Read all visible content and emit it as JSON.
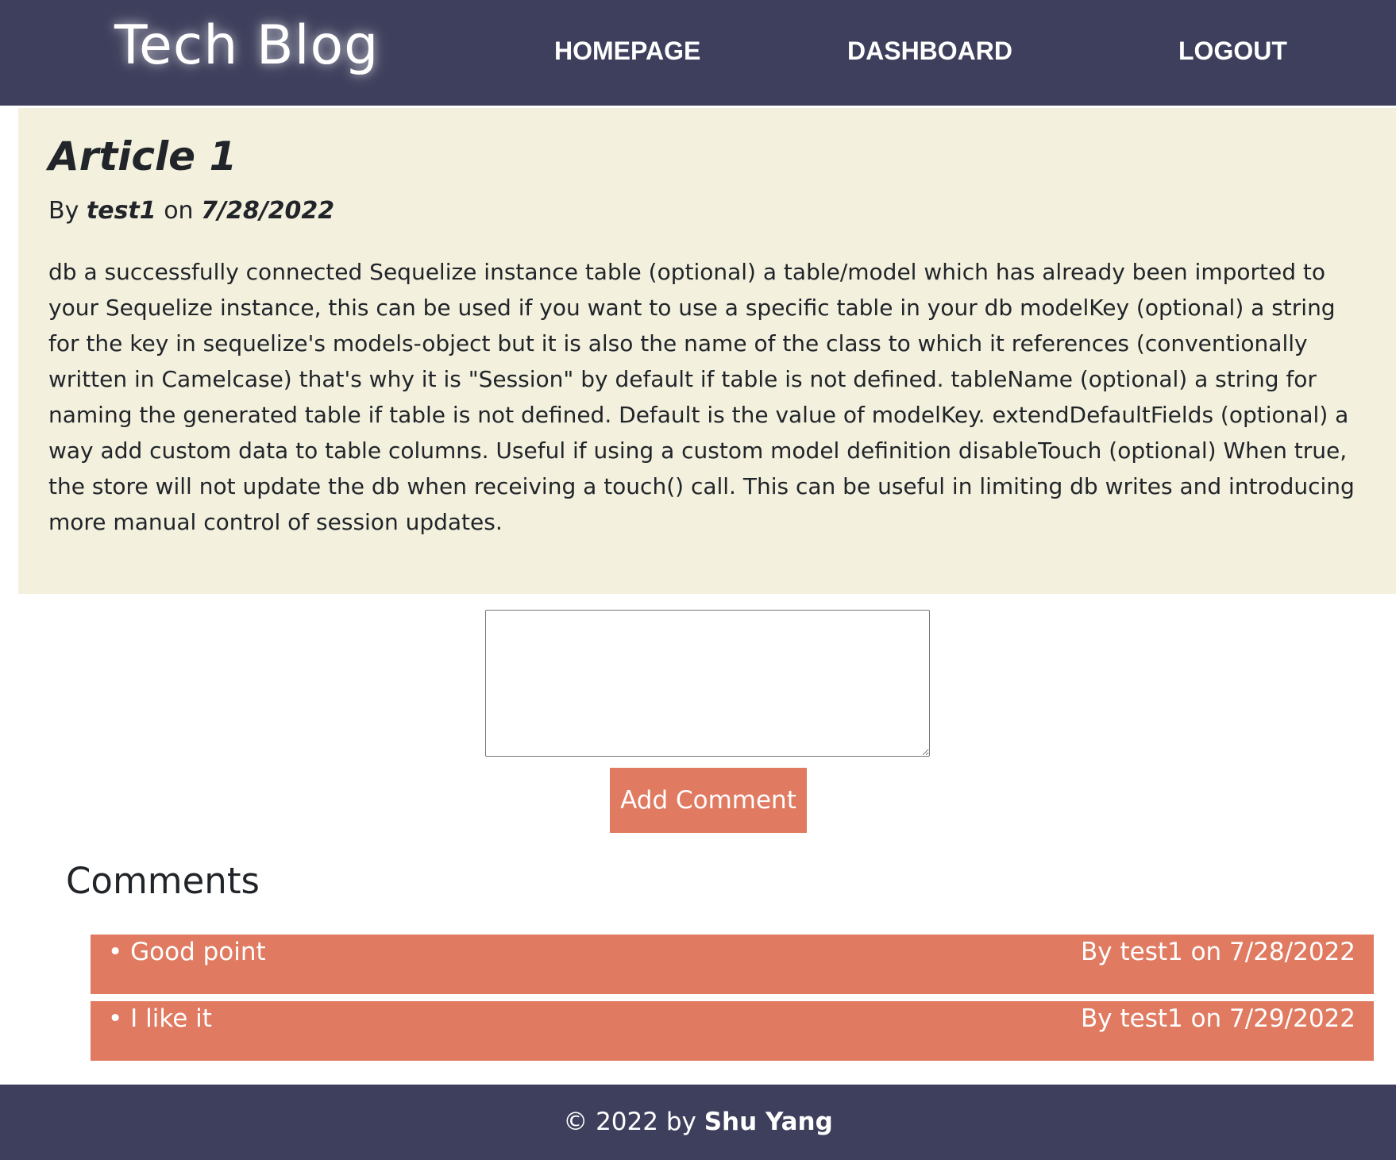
{
  "header": {
    "logo": "Tech Blog",
    "nav": {
      "homepage": "HOMEPAGE",
      "dashboard": "DASHBOARD",
      "logout": "LOGOUT"
    }
  },
  "article": {
    "title": "Article 1",
    "by_label": "By",
    "author": "test1",
    "on_label": "on",
    "date": "7/28/2022",
    "body": "db a successfully connected Sequelize instance table (optional) a table/model which has already been imported to your Sequelize instance, this can be used if you want to use a specific table in your db modelKey (optional) a string for the key in sequelize's models-object but it is also the name of the class to which it references (conventionally written in Camelcase) that's why it is \"Session\" by default if table is not defined. tableName (optional) a string for naming the generated table if table is not defined. Default is the value of modelKey. extendDefaultFields (optional) a way add custom data to table columns. Useful if using a custom model definition disableTouch (optional) When true, the store will not update the db when receiving a touch() call. This can be useful in limiting db writes and introducing more manual control of session updates."
  },
  "comment_form": {
    "value": "",
    "button_label": "Add Comment"
  },
  "comments": {
    "heading": "Comments",
    "items": [
      {
        "text": "• Good point",
        "meta": "By test1 on 7/28/2022"
      },
      {
        "text": "• I like it",
        "meta": "By test1 on 7/29/2022"
      }
    ]
  },
  "footer": {
    "prefix": "© 2022 by",
    "author": "Shu Yang"
  },
  "colors": {
    "header_bg": "#3d3f5c",
    "article_bg": "#f3f0de",
    "accent": "#e07a60",
    "text": "#212529"
  }
}
